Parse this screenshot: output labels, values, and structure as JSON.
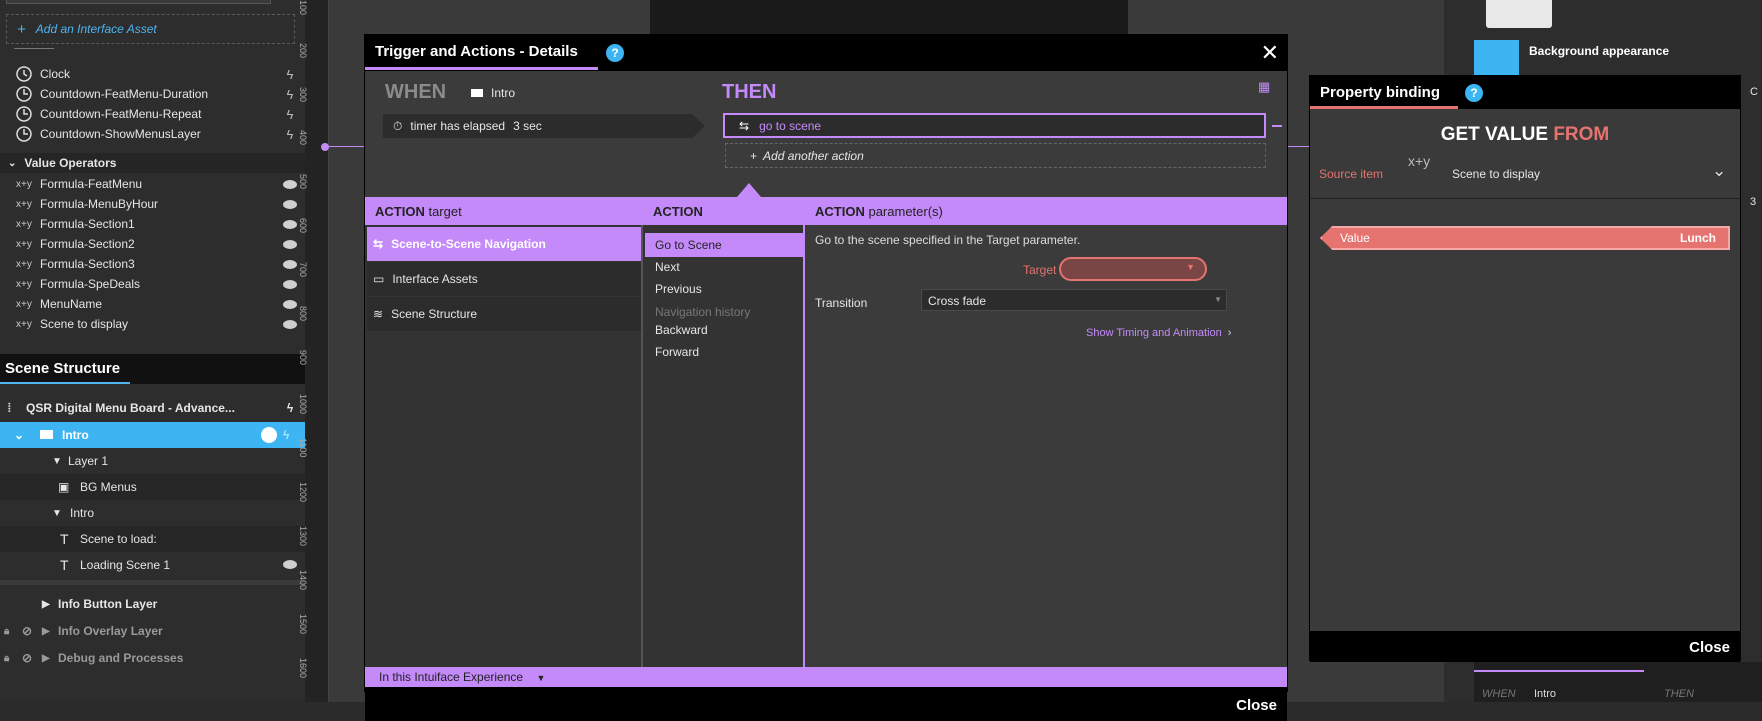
{
  "left_panel": {
    "add_asset_label": "Add an Interface Asset",
    "properties": [
      {
        "label": "Clock",
        "icon": "clock-icon"
      },
      {
        "label": "Countdown-FeatMenu-Duration",
        "icon": "countdown-icon"
      },
      {
        "label": "Countdown-FeatMenu-Repeat",
        "icon": "countdown-icon"
      },
      {
        "label": "Countdown-ShowMenusLayer",
        "icon": "countdown-icon"
      }
    ],
    "value_operators_header": "Value Operators",
    "value_operators": [
      "Formula-FeatMenu",
      "Formula-MenuByHour",
      "Formula-Section1",
      "Formula-Section2",
      "Formula-Section3",
      "Formula-SpeDeals",
      "MenuName",
      "Scene to display"
    ],
    "formula_glyph": "x+y",
    "scene_structure_title": "Scene Structure",
    "tree": [
      {
        "label": "QSR Digital Menu Board - Advance..."
      },
      {
        "label": "Intro"
      },
      {
        "label": "Layer 1"
      },
      {
        "label": "BG Menus"
      },
      {
        "label": "Intro"
      },
      {
        "label": "Scene to load:"
      },
      {
        "label": "Loading Scene 1"
      },
      {
        "label": "Info Button Layer"
      },
      {
        "label": "Info Overlay Layer"
      },
      {
        "label": "Debug and Processes"
      }
    ]
  },
  "ruler": [
    "100",
    "200",
    "300",
    "400",
    "500",
    "600",
    "700",
    "800",
    "900",
    "1000",
    "1100",
    "1200",
    "1300",
    "1400",
    "1500",
    "1600"
  ],
  "dialog": {
    "title": "Trigger and Actions - Details",
    "help": "?",
    "close_icon": "✕",
    "when_label": "WHEN",
    "when_source": "Intro",
    "trigger_text": "timer has elapsed",
    "trigger_value": "3 sec",
    "then_label": "THEN",
    "action_text": "go to scene",
    "add_action_label": "Add another action",
    "col_headers": {
      "target_bold": "ACTION",
      "target_rest": "target",
      "action_bold": "ACTION",
      "param_bold": "ACTION",
      "param_rest": "parameter(s)"
    },
    "targets": [
      {
        "label": "Scene-to-Scene Navigation",
        "selected": true
      },
      {
        "label": "Interface Assets",
        "selected": false
      },
      {
        "label": "Scene Structure",
        "selected": false
      }
    ],
    "actions": {
      "go_to_scene": "Go to Scene",
      "next": "Next",
      "previous": "Previous",
      "nav_history": "Navigation history",
      "backward": "Backward",
      "forward": "Forward"
    },
    "param_description": "Go to the scene specified in the Target parameter.",
    "target_label": "Target",
    "transition_label": "Transition",
    "transition_value": "Cross fade",
    "timing_link": "Show Timing and Animation",
    "footer_scope": "In this Intuiface Experience",
    "close_label": "Close"
  },
  "binding": {
    "title": "Property binding",
    "help": "?",
    "heading_left": "GET VALUE",
    "heading_right": "FROM",
    "source_label": "Source item",
    "source_value": "Scene to display",
    "value_label": "Value",
    "value_result": "Lunch",
    "close_label": "Close"
  },
  "right_panel": {
    "background_appearance": "Background appearance",
    "bottom_when": "WHEN",
    "bottom_intro": "Intro",
    "bottom_then": "THEN",
    "edge_c": "C",
    "edge_3": "3"
  },
  "colors": {
    "accent_purple": "#c58af9",
    "accent_blue": "#3db5f2",
    "error_red": "#e5736f"
  }
}
